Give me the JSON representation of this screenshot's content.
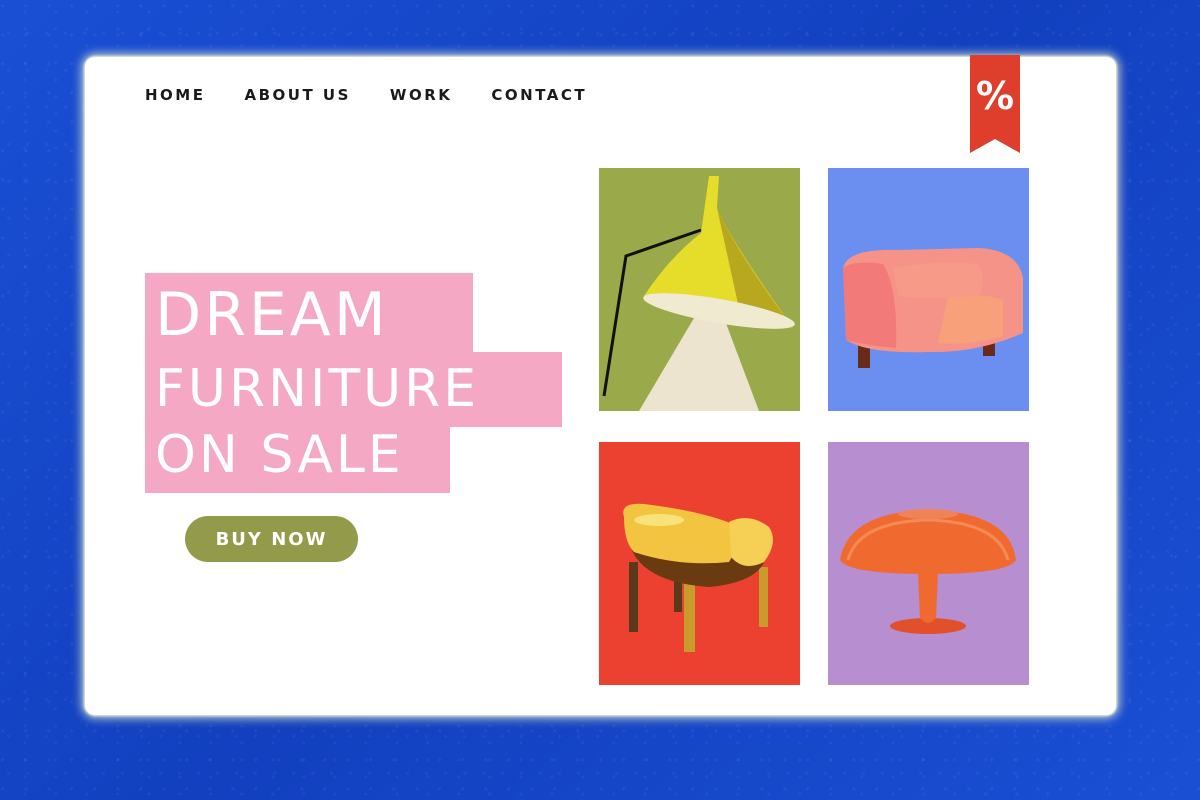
{
  "nav": {
    "items": [
      {
        "label": "HOME"
      },
      {
        "label": "ABOUT US"
      },
      {
        "label": "WORK"
      },
      {
        "label": "CONTACT"
      }
    ]
  },
  "sale_badge": {
    "symbol": "%",
    "color": "#de3e2b"
  },
  "hero": {
    "line1": "DREAM",
    "line2": "FURNITURE",
    "line3": "ON SALE",
    "highlight_color": "#f5a8c3",
    "cta_label": "BUY NOW",
    "cta_color": "#939a49"
  },
  "products": [
    {
      "name": "floor-lamp",
      "bg": "#9aa94a"
    },
    {
      "name": "armchair",
      "bg": "#6a8ff0"
    },
    {
      "name": "chair",
      "bg": "#ec4030"
    },
    {
      "name": "table-lamp",
      "bg": "#b78ed0"
    }
  ]
}
